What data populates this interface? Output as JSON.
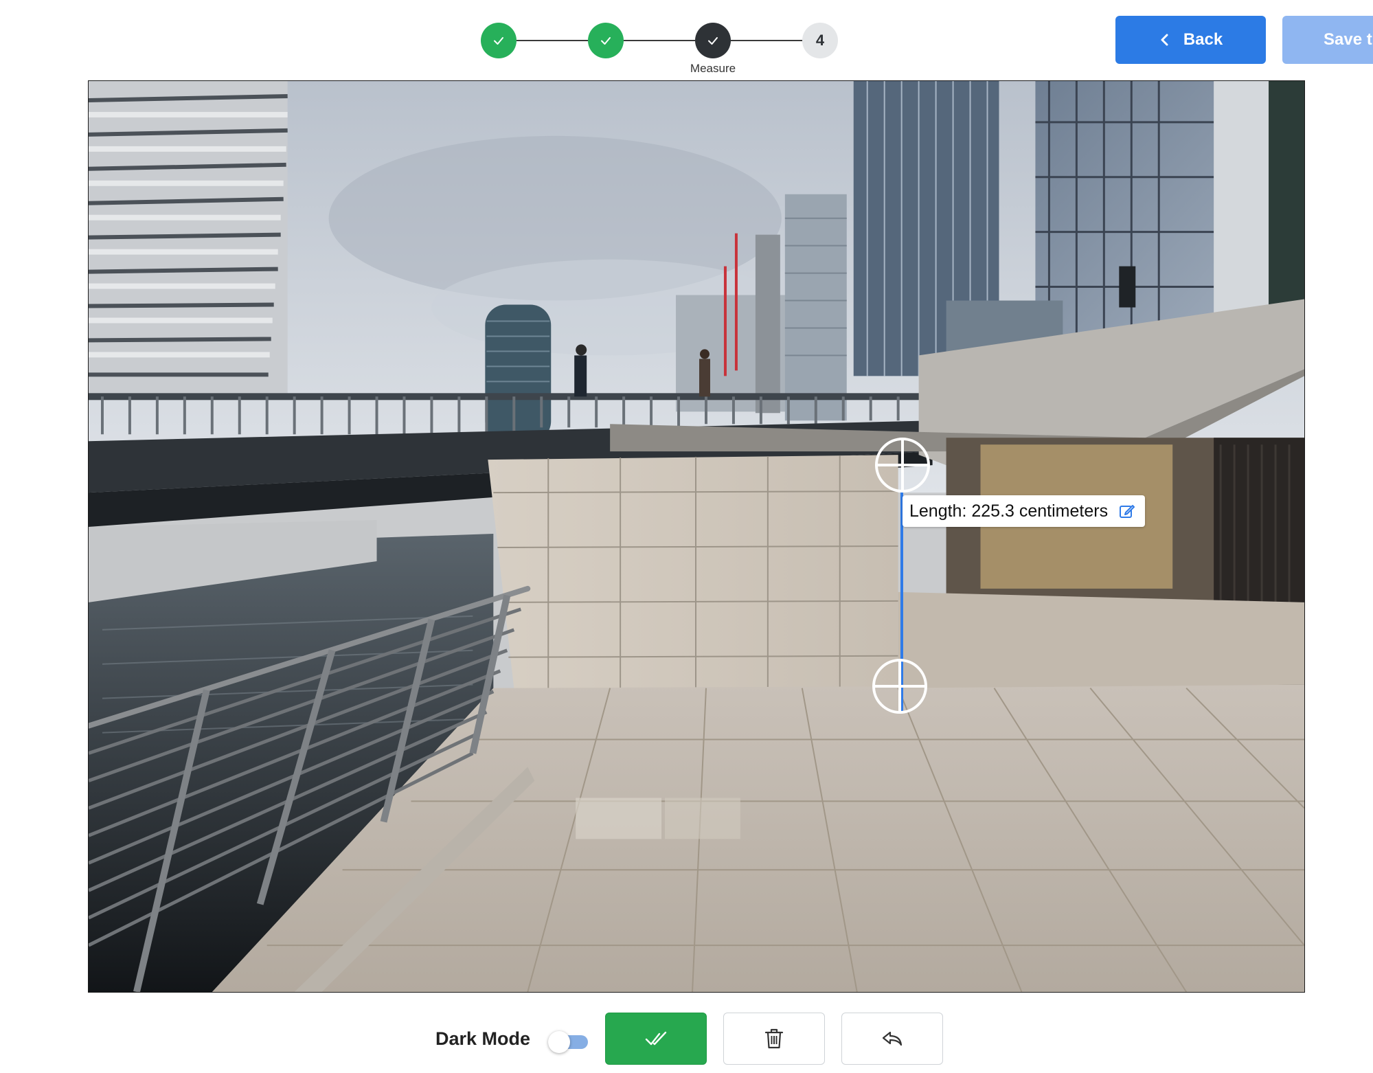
{
  "stepper": {
    "steps": [
      {
        "state": "done",
        "icon": "check-icon",
        "number": "1"
      },
      {
        "state": "done",
        "icon": "check-icon",
        "number": "2"
      },
      {
        "state": "active",
        "icon": "check-icon",
        "number": "3",
        "label": "Measure"
      },
      {
        "state": "todo",
        "number": "4"
      }
    ]
  },
  "header": {
    "back_label": "Back",
    "back_icon": "chevron-left-icon",
    "save_label": "Save t"
  },
  "measurement": {
    "label": "Length: 225.3 centimeters",
    "edit_icon": "edit-icon",
    "start_marker_icon": "crosshair-icon",
    "end_marker_icon": "crosshair-icon"
  },
  "toolbar": {
    "dark_mode_label": "Dark Mode",
    "dark_mode_on": false,
    "confirm_icon": "double-check-icon",
    "delete_icon": "trash-icon",
    "undo_icon": "undo-icon"
  },
  "colors": {
    "primary": "#2c7be5",
    "success": "#27b05a",
    "active_step": "#2e3236",
    "measure_line": "#2f7be8"
  }
}
